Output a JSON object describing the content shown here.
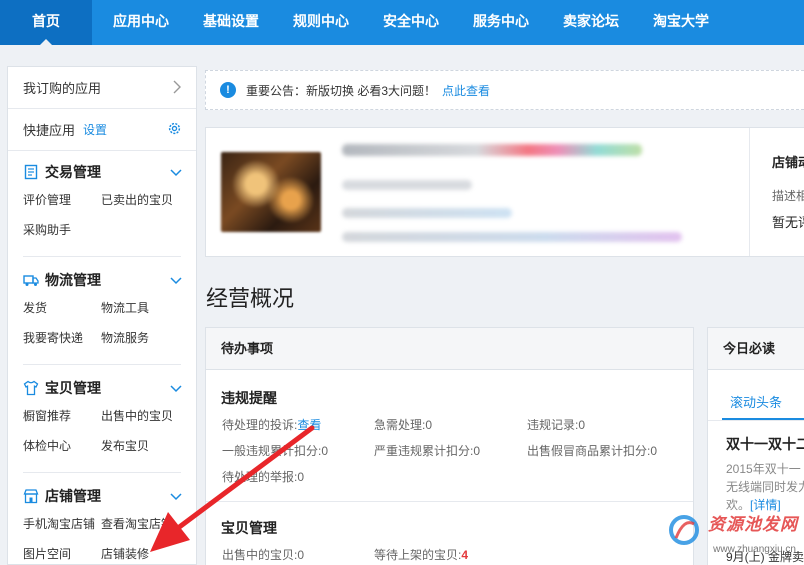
{
  "nav": {
    "items": [
      "首页",
      "应用中心",
      "基础设置",
      "规则中心",
      "安全中心",
      "服务中心",
      "卖家论坛",
      "淘宝大学"
    ],
    "active_index": 0
  },
  "sidebar": {
    "subscribed_apps": "我订购的应用",
    "quick_apps": "快捷应用",
    "quick_settings": "设置",
    "sections": [
      {
        "title": "交易管理",
        "icon": "order-icon",
        "links": [
          "评价管理",
          "已卖出的宝贝",
          "采购助手"
        ]
      },
      {
        "title": "物流管理",
        "icon": "truck-icon",
        "links": [
          "发货",
          "物流工具",
          "我要寄快递",
          "物流服务"
        ]
      },
      {
        "title": "宝贝管理",
        "icon": "shirt-icon",
        "links": [
          "橱窗推荐",
          "出售中的宝贝",
          "体检中心",
          "发布宝贝"
        ]
      },
      {
        "title": "店铺管理",
        "icon": "store-icon",
        "links": [
          "手机淘宝店铺",
          "查看淘宝店铺",
          "图片空间",
          "店铺装修"
        ]
      }
    ]
  },
  "notice": {
    "text": "重要公告：新版切换 必看3大问题！",
    "link": "点此查看"
  },
  "shop": {
    "side_title": "店铺动",
    "side_desc": "描述相",
    "side_status": "暂无评"
  },
  "overview_title": "经营概况",
  "todo": {
    "title": "待办事项",
    "violation": {
      "title": "违规提醒",
      "items": [
        {
          "label": "待处理的投诉:",
          "value": "查看"
        },
        {
          "label": "急需处理:",
          "value": "0"
        },
        {
          "label": "违规记录:",
          "value": "0"
        },
        {
          "label": "一般违规累计扣分:",
          "value": "0"
        },
        {
          "label": "严重违规累计扣分:",
          "value": "0"
        },
        {
          "label": "出售假冒商品累计扣分:",
          "value": "0"
        },
        {
          "label": "待处理的举报:",
          "value": "0"
        }
      ]
    },
    "goods": {
      "title": "宝贝管理",
      "items": [
        {
          "label": "出售中的宝贝:",
          "value": "0"
        },
        {
          "label": "等待上架的宝贝:",
          "value": "4"
        }
      ]
    }
  },
  "read": {
    "title": "今日必读",
    "tab": "滚动头条",
    "headline": "双十一双十二",
    "line1": "2015年双十一",
    "line2": "无线端同时发力",
    "line3_pre": "欢。",
    "line3_link": "[详情]",
    "date": "9月(上)  金牌卖"
  },
  "watermark": {
    "text": "资源池发网",
    "sub": "www.zhuangxiu.cn"
  },
  "colors": {
    "brand": "#1a8be0",
    "nav_active": "#0d6fc2",
    "alert": "#e4393c"
  }
}
